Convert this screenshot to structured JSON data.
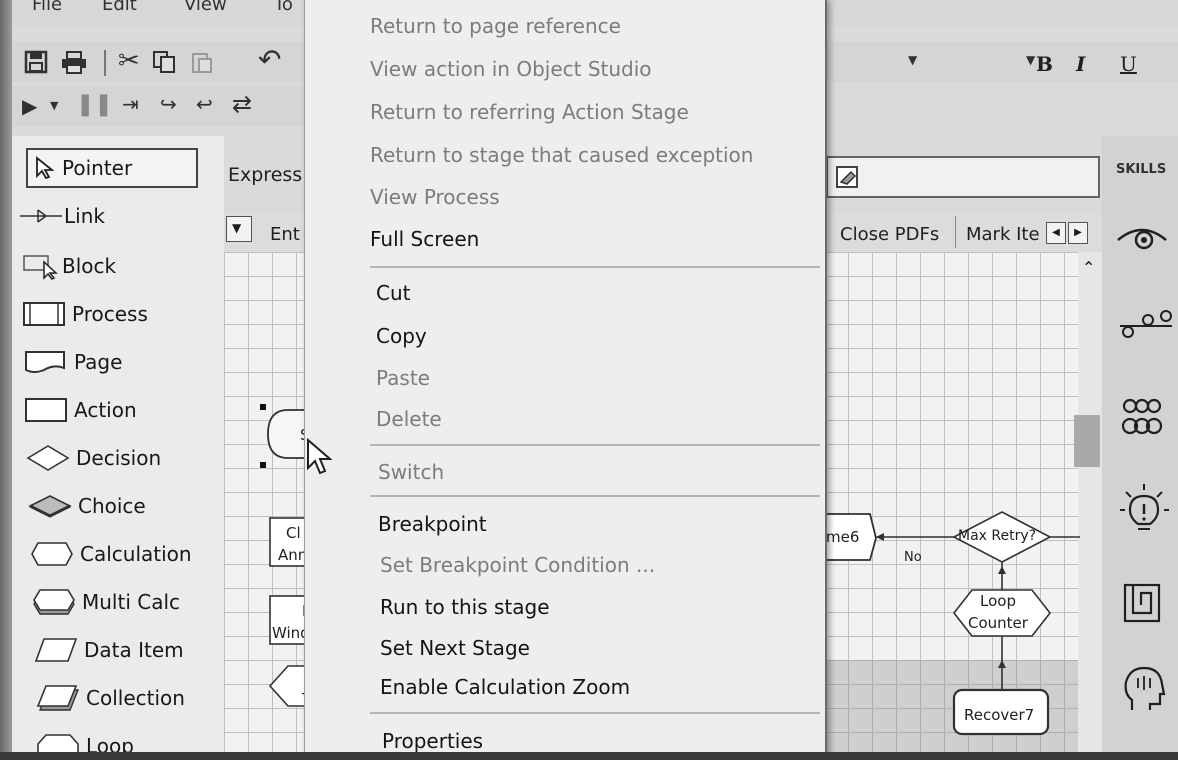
{
  "menu_bar": {
    "file": "File",
    "edit": "Edit",
    "view": "View",
    "tools": "To"
  },
  "format_toolbar": {
    "bold": "B",
    "italic": "I",
    "underline": "U"
  },
  "palette": {
    "items": [
      {
        "label": "Pointer",
        "icon": "pointer-arrow-icon"
      },
      {
        "label": "Link",
        "icon": "link-icon"
      },
      {
        "label": "Block",
        "icon": "block-icon"
      },
      {
        "label": "Process",
        "icon": "process-icon"
      },
      {
        "label": "Page",
        "icon": "page-icon"
      },
      {
        "label": "Action",
        "icon": "action-icon"
      },
      {
        "label": "Decision",
        "icon": "decision-icon"
      },
      {
        "label": "Choice",
        "icon": "choice-icon"
      },
      {
        "label": "Calculation",
        "icon": "calculation-icon"
      },
      {
        "label": "Multi Calc",
        "icon": "multi-calc-icon"
      },
      {
        "label": "Data Item",
        "icon": "data-item-icon"
      },
      {
        "label": "Collection",
        "icon": "collection-icon"
      },
      {
        "label": "Loop",
        "icon": "loop-icon"
      }
    ]
  },
  "expression": {
    "label": "Express"
  },
  "page_tabs": {
    "first": "Ent",
    "close_pdfs": "Close PDFs",
    "mark_items": "Mark Ite"
  },
  "skills_panel": {
    "title": "SKILLS"
  },
  "context_menu": {
    "group1": [
      {
        "label": "Return to page reference",
        "enabled": false
      },
      {
        "label": "View action in Object Studio",
        "enabled": false
      },
      {
        "label": "Return to referring Action Stage",
        "enabled": false
      },
      {
        "label": "Return to stage that caused exception",
        "enabled": false
      },
      {
        "label": "View Process",
        "enabled": false
      },
      {
        "label": "Full Screen",
        "enabled": true
      }
    ],
    "group2": [
      {
        "label": "Cut",
        "enabled": true
      },
      {
        "label": "Copy",
        "enabled": true
      },
      {
        "label": "Paste",
        "enabled": false
      },
      {
        "label": "Delete",
        "enabled": false
      }
    ],
    "group3": [
      {
        "label": "Switch",
        "enabled": false
      }
    ],
    "group4": [
      {
        "label": "Breakpoint",
        "enabled": true
      },
      {
        "label": "Set Breakpoint Condition ...",
        "enabled": false
      },
      {
        "label": "Run to this stage",
        "enabled": true
      },
      {
        "label": "Set Next Stage",
        "enabled": true
      },
      {
        "label": "Enable Calculation Zoom",
        "enabled": true
      }
    ],
    "group5": [
      {
        "label": "Properties",
        "enabled": true
      }
    ]
  },
  "diagram": {
    "left_stages": {
      "start_fragment": "S",
      "stage2_a": "Cl",
      "stage2_b": "Ann",
      "stage3_a": "R",
      "stage3_b": "Wind",
      "stage4": "T"
    },
    "stage_partial": "me6",
    "decision": "Max Retry?",
    "no_label": "No",
    "loop_a": "Loop",
    "loop_b": "Counter",
    "recover": "Recover7"
  }
}
